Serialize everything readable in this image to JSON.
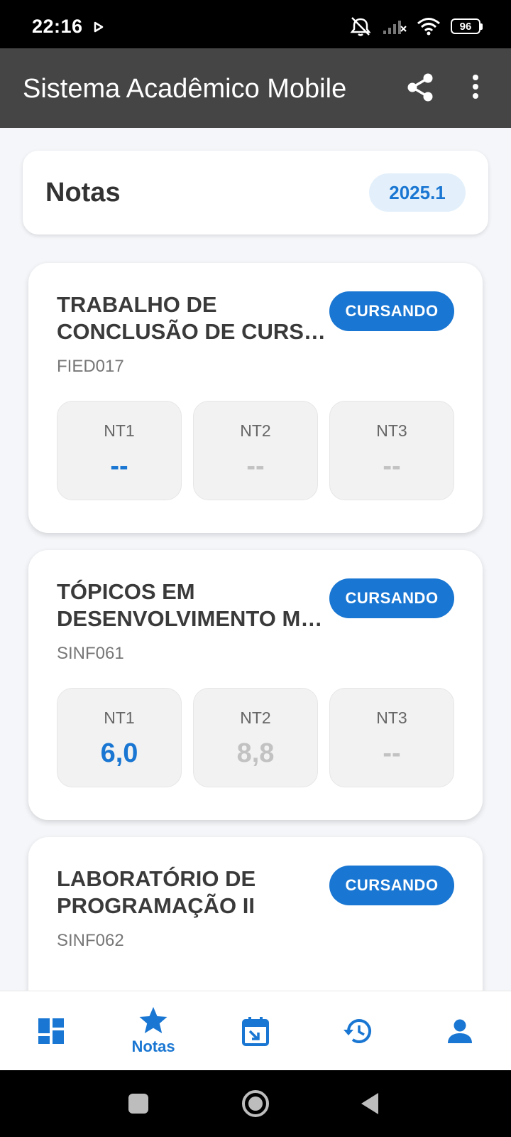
{
  "status_bar": {
    "time": "22:16",
    "battery": "96",
    "icons": [
      "play-icon",
      "silent-alarm-icon",
      "signal-off-icon",
      "wifi-icon",
      "battery-icon"
    ]
  },
  "app_bar": {
    "title": "Sistema Acadêmico Mobile",
    "icons": [
      "share-icon",
      "more-vert-icon"
    ]
  },
  "header": {
    "title": "Notas",
    "semester": "2025.1"
  },
  "courses": [
    {
      "name_line1": "TRABALHO DE",
      "name_line2": "CONCLUSÃO DE CURSO II",
      "code": "FIED017",
      "status": "CURSANDO",
      "grades": [
        {
          "label": "NT1",
          "value": "--"
        },
        {
          "label": "NT2",
          "value": "--"
        },
        {
          "label": "NT3",
          "value": "--"
        }
      ]
    },
    {
      "name_line1": "TÓPICOS EM",
      "name_line2": "DESENVOLVIMENTO MO...",
      "code": "SINF061",
      "status": "CURSANDO",
      "grades": [
        {
          "label": "NT1",
          "value": "6,0"
        },
        {
          "label": "NT2",
          "value": "8,8"
        },
        {
          "label": "NT3",
          "value": "--"
        }
      ]
    },
    {
      "name_line1": "LABORATÓRIO DE",
      "name_line2": "PROGRAMAÇÃO II",
      "code": "SINF062",
      "status": "CURSANDO"
    }
  ],
  "bottom_nav": {
    "active_label": "Notas",
    "items": [
      "dashboard-icon",
      "star-icon",
      "calendar-icon",
      "history-icon",
      "person-icon"
    ]
  },
  "colors": {
    "primary": "#1976d2",
    "app_bar": "#454545",
    "background": "#f4f6f9",
    "badge_bg": "#e3f0fb"
  }
}
